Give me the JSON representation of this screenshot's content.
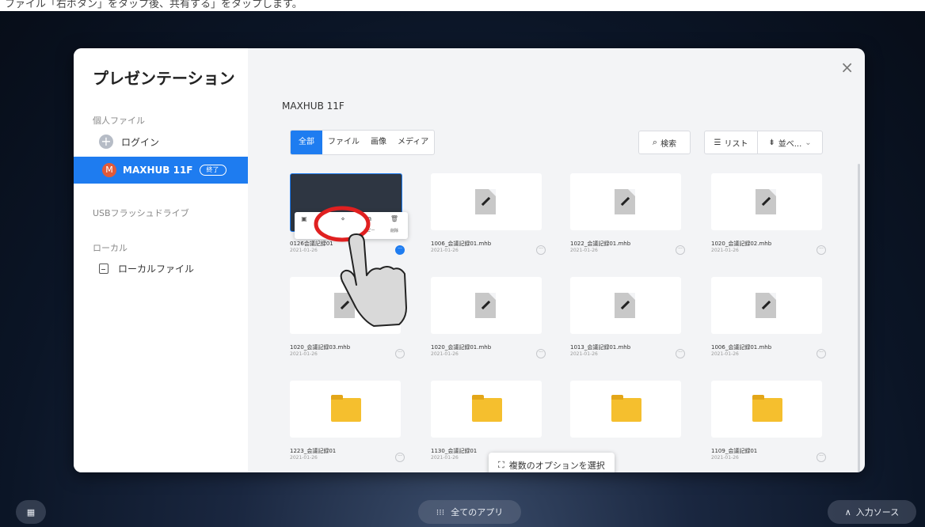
{
  "caption": "ファイル「右ボタン」をタップ後、共有する」をタップします。",
  "dialog": {
    "title": "プレゼンテーション",
    "close_label": "×",
    "device_title": "MAXHUB 11F"
  },
  "sidebar": {
    "personal_files_label": "個人ファイル",
    "login_label": "ログイン",
    "account_label": "MAXHUB 11F",
    "account_avatar": "M",
    "end_badge": "終了",
    "usb_label": "USBフラッシュドライブ",
    "local_section_label": "ローカル",
    "local_files_label": "ローカルファイル"
  },
  "filter_tabs": [
    "全部",
    "ファイル",
    "画像",
    "メディア"
  ],
  "toolbar": {
    "search_label": "検索",
    "list_label": "リスト",
    "sort_label": "並べ..."
  },
  "files": [
    {
      "name": "0126会議記録01",
      "date": "2021-01-26",
      "type": "board"
    },
    {
      "name": "1006_会議記録01.mhb",
      "date": "2021-01-26",
      "type": "doc"
    },
    {
      "name": "1022_会議記録01.mhb",
      "date": "2021-01-26",
      "type": "doc"
    },
    {
      "name": "1020_会議記録02.mhb",
      "date": "2021-01-26",
      "type": "doc"
    },
    {
      "name": "1020_会議記録03.mhb",
      "date": "2021-01-26",
      "type": "doc"
    },
    {
      "name": "1020_会議記録01.mhb",
      "date": "2021-01-26",
      "type": "doc"
    },
    {
      "name": "1013_会議記録01.mhb",
      "date": "2021-01-26",
      "type": "doc"
    },
    {
      "name": "1006_会議記録01.mhb",
      "date": "2021-01-26",
      "type": "doc"
    },
    {
      "name": "1223_会議記録01",
      "date": "2021-01-26",
      "type": "folder"
    },
    {
      "name": "1130_会議記録01",
      "date": "2021-01-26",
      "type": "folder"
    },
    {
      "name": "",
      "date": "",
      "type": "folder"
    },
    {
      "name": "1109_会議記録01",
      "date": "2021-01-26",
      "type": "folder"
    }
  ],
  "context_menu": {
    "copy_label": "コピー",
    "delete_label": "削除"
  },
  "multi_select_label": "複数のオプションを選択",
  "taskbar": {
    "all_apps_label": "全てのアプリ",
    "input_source_label": "入力ソース"
  },
  "colors": {
    "accent": "#1e7cf0",
    "highlight": "#e02020"
  }
}
